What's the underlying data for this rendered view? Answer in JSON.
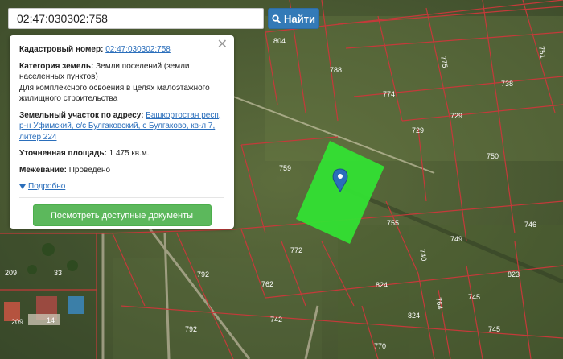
{
  "search": {
    "value": "02:47:030302:758",
    "button_label": "Найти"
  },
  "popup": {
    "cadastral_label": "Кадастровый номер:",
    "cadastral_value": "02:47:030302:758",
    "category_label": "Категория земель:",
    "category_value": "Земли поселений (земли населенных пунктов)",
    "usage_value": "Для комплексного освоения в целях малоэтажного жилищного строительства",
    "address_label": "Земельный участок по адресу:",
    "address_value": "Башкортостан респ, р-н Уфимский, с/с Булгаковский, с Булгаково, кв-л 7, литер 224",
    "area_label": "Уточненная площадь:",
    "area_value": "1 475 кв.м.",
    "survey_label": "Межевание:",
    "survey_value": "Проведено",
    "more_label": "Подробно",
    "docs_button": "Посмотреть доступные документы"
  },
  "parcel_labels": [
    "804",
    "775",
    "751",
    "788",
    "738",
    "774",
    "729",
    "729",
    "750",
    "759",
    "755",
    "746",
    "749",
    "740",
    "772",
    "792",
    "762",
    "824",
    "823",
    "745",
    "764",
    "742",
    "792",
    "824",
    "745",
    "770",
    "209",
    "33",
    "209",
    "14"
  ],
  "colors": {
    "parcel_fill": "#33e033",
    "boundary": "#c43a3a",
    "accent": "#337ab7",
    "button_green": "#5cb85c"
  },
  "icons": [
    "search-icon",
    "close-icon",
    "chevron-down-icon",
    "map-pin-icon"
  ]
}
